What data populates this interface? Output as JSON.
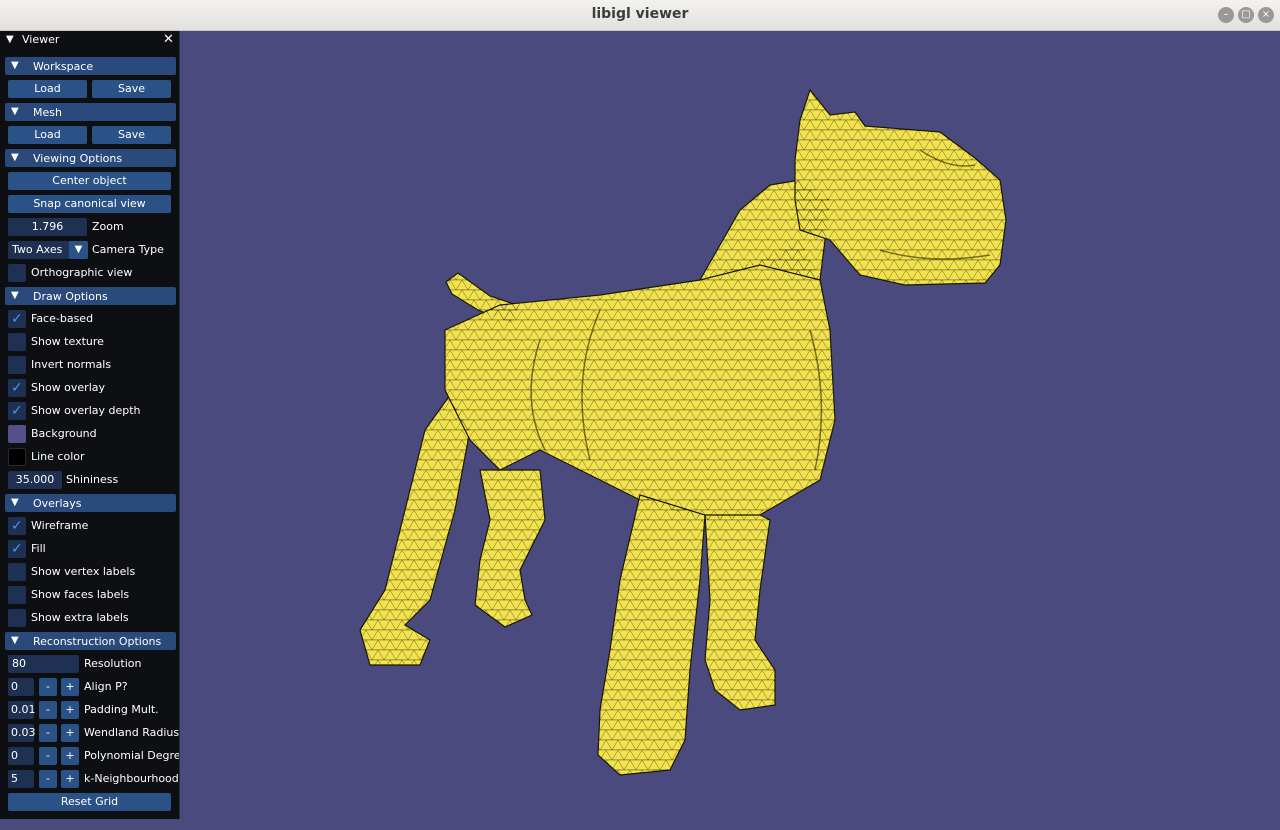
{
  "window": {
    "title": "libigl viewer"
  },
  "panel": {
    "title": "Viewer",
    "workspace": {
      "header": "Workspace",
      "load": "Load",
      "save": "Save"
    },
    "mesh": {
      "header": "Mesh",
      "load": "Load",
      "save": "Save"
    },
    "viewing": {
      "header": "Viewing Options",
      "center": "Center object",
      "snap": "Snap canonical view",
      "zoom_value": "1.796",
      "zoom_label": "Zoom",
      "camera_value": "Two Axes",
      "camera_label": "Camera Type",
      "ortho_label": "Orthographic view"
    },
    "draw": {
      "header": "Draw Options",
      "face_based": "Face-based",
      "show_texture": "Show texture",
      "invert_normals": "Invert normals",
      "show_overlay": "Show overlay",
      "show_overlay_depth": "Show overlay depth",
      "background": "Background",
      "line_color": "Line color",
      "shininess_value": "35.000",
      "shininess_label": "Shininess"
    },
    "overlays": {
      "header": "Overlays",
      "wireframe": "Wireframe",
      "fill": "Fill",
      "vertex_labels": "Show vertex labels",
      "faces_labels": "Show faces labels",
      "extra_labels": "Show extra labels"
    },
    "reconstruction": {
      "header": "Reconstruction Options",
      "resolution_value": "80",
      "resolution_label": "Resolution",
      "steppers": [
        {
          "value": "0",
          "label": "Align P?"
        },
        {
          "value": "0.01",
          "label": "Padding Mult."
        },
        {
          "value": "0.03",
          "label": "Wendland Radius"
        },
        {
          "value": "0",
          "label": "Polynomial Degree"
        },
        {
          "value": "5",
          "label": "k-Neighbourhood"
        }
      ],
      "reset": "Reset Grid"
    },
    "minus": "-",
    "plus": "+"
  },
  "colors": {
    "viewport_background": "#4b4a7e",
    "mesh_fill": "#f2e24d",
    "wireframe": "#000000",
    "background_swatch": "#55508a",
    "line_color_swatch": "#000000"
  },
  "viewport": {
    "model": "dog-mesh"
  }
}
